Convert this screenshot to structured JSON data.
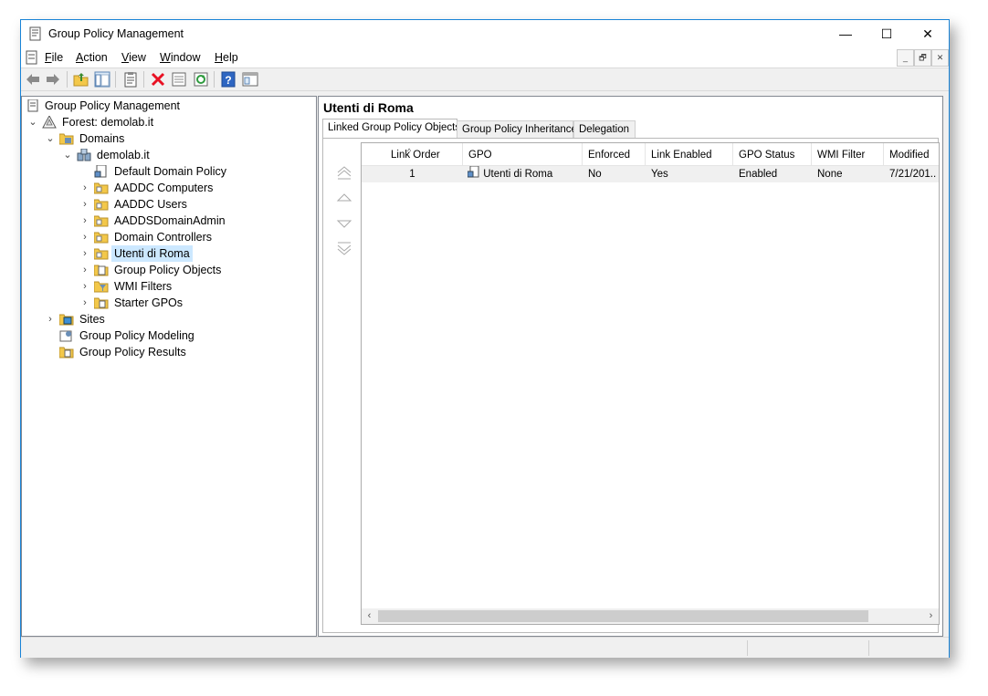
{
  "window": {
    "title": "Group Policy Management"
  },
  "window_controls": {
    "minimize": "—",
    "maximize": "☐",
    "close": "✕"
  },
  "menu": [
    {
      "accel": "F",
      "rest": "ile"
    },
    {
      "accel": "A",
      "rest": "ction"
    },
    {
      "accel": "V",
      "rest": "iew"
    },
    {
      "accel": "W",
      "rest": "indow"
    },
    {
      "accel": "H",
      "rest": "elp"
    }
  ],
  "mdi_controls": {
    "minimize": "_",
    "restore": "🗗",
    "close": "✕"
  },
  "tree": {
    "root": "Group Policy Management",
    "forest": "Forest: demolab.it",
    "domains": "Domains",
    "domain": "demolab.it",
    "children": [
      "Default Domain Policy",
      "AADDC Computers",
      "AADDC Users",
      "AADDSDomainAdmin",
      "Domain Controllers",
      "Utenti di Roma",
      "Group Policy Objects",
      "WMI Filters",
      "Starter GPOs"
    ],
    "sites": "Sites",
    "modeling": "Group Policy Modeling",
    "results": "Group Policy Results",
    "selected": "Utenti di Roma"
  },
  "details": {
    "title": "Utenti di Roma",
    "tabs": [
      "Linked Group Policy Objects",
      "Group Policy Inheritance",
      "Delegation"
    ],
    "active_tab": "Linked Group Policy Objects",
    "columns": [
      "Link Order",
      "GPO",
      "Enforced",
      "Link Enabled",
      "GPO Status",
      "WMI Filter",
      "Modified"
    ],
    "rows": [
      {
        "link_order": "1",
        "gpo": "Utenti di Roma",
        "enforced": "No",
        "link_enabled": "Yes",
        "gpo_status": "Enabled",
        "wmi_filter": "None",
        "modified": "7/21/201.."
      }
    ]
  },
  "icons": {
    "order_buttons": [
      "move-to-top-icon",
      "move-up-icon",
      "move-down-icon",
      "move-to-bottom-icon"
    ],
    "toolbar": [
      "back-arrow-icon",
      "forward-arrow-icon",
      "up-folder-icon",
      "show-hide-tree-icon",
      "properties-icon",
      "delete-icon",
      "export-list-icon",
      "refresh-icon",
      "help-icon",
      "console-icon"
    ]
  },
  "colors": {
    "selection": "#cce8ff",
    "window_border": "#1883d7",
    "delete_red": "#e81123"
  }
}
